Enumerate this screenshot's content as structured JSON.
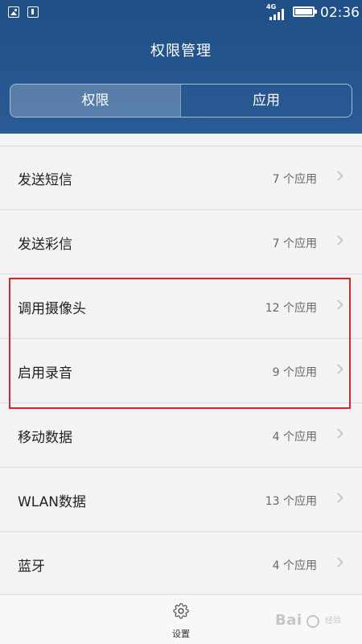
{
  "status_bar": {
    "network": "4G",
    "time": "02:36",
    "icons": [
      "image-icon",
      "sim-icon",
      "signal-icon",
      "battery-icon"
    ]
  },
  "header": {
    "title": "权限管理",
    "tabs": [
      {
        "label": "权限",
        "active": true
      },
      {
        "label": "应用",
        "active": false
      }
    ],
    "accent_color": "#2a5b95"
  },
  "permissions": [
    {
      "label": "发送短信",
      "count": "7 个应用"
    },
    {
      "label": "发送彩信",
      "count": "7 个应用"
    },
    {
      "label": "调用摄像头",
      "count": "12 个应用"
    },
    {
      "label": "启用录音",
      "count": "9 个应用"
    },
    {
      "label": "移动数据",
      "count": "4 个应用"
    },
    {
      "label": "WLAN数据",
      "count": "13 个应用"
    },
    {
      "label": "蓝牙",
      "count": "4 个应用"
    }
  ],
  "highlight": {
    "color": "#d9232d",
    "rows": [
      "调用摄像头",
      "启用录音"
    ]
  },
  "bottom_bar": {
    "settings_label": "设置",
    "settings_icon": "gear-icon"
  },
  "watermark": {
    "main": "Bai",
    "sub": "经验"
  }
}
